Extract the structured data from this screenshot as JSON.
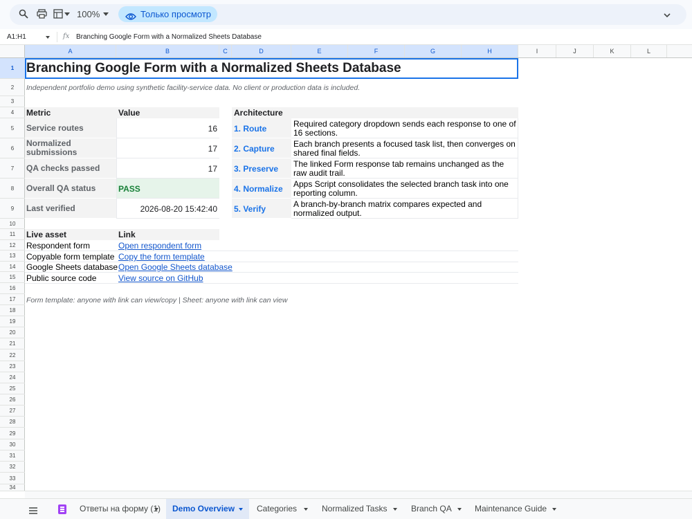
{
  "toolbar": {
    "zoom": "100%",
    "view_only_label": "Только просмотр"
  },
  "formula_bar": {
    "cell_ref": "A1:H1",
    "content": "Branching Google Form with a Normalized Sheets Database"
  },
  "columns": [
    "A",
    "B",
    "C",
    "D",
    "E",
    "F",
    "G",
    "H",
    "I",
    "J",
    "K",
    "L"
  ],
  "rows": [
    "1",
    "2",
    "3",
    "4",
    "5",
    "6",
    "7",
    "8",
    "9",
    "10",
    "11",
    "12",
    "13",
    "14",
    "15",
    "16",
    "17",
    "18",
    "19",
    "20",
    "21",
    "22",
    "23",
    "24",
    "25",
    "26",
    "27",
    "28",
    "29",
    "30",
    "31",
    "32",
    "33",
    "34"
  ],
  "sheet": {
    "title": "Branching Google Form with a Normalized Sheets Database",
    "subtitle": "Independent portfolio demo using synthetic facility-service data. No client or production data is included.",
    "metrics_header": {
      "metric": "Metric",
      "value": "Value"
    },
    "metrics": [
      {
        "label": "Service routes",
        "value": "16"
      },
      {
        "label": "Normalized submissions",
        "label_line1": "Normalized",
        "label_line2": "submissions",
        "value": "17"
      },
      {
        "label": "QA checks passed",
        "value": "17"
      },
      {
        "label": "Overall QA status",
        "value": "PASS",
        "status_color": "#188038"
      },
      {
        "label": "Last verified",
        "value": "2026-08-20 15:42:40"
      }
    ],
    "architecture_header": "Architecture",
    "architecture": [
      {
        "step": "1. Route",
        "desc": "Required category dropdown sends each response to one of 16 sections."
      },
      {
        "step": "2. Capture",
        "desc": "Each branch presents a focused task list, then converges on shared final fields."
      },
      {
        "step": "3. Preserve",
        "desc": "The linked Form response tab remains unchanged as the raw audit trail."
      },
      {
        "step": "4. Normalize",
        "desc": "Apps Script consolidates the selected branch task into one reporting column."
      },
      {
        "step": "5. Verify",
        "desc": "A branch-by-branch matrix compares expected and normalized output."
      }
    ],
    "assets_header": {
      "asset": "Live asset",
      "link": "Link"
    },
    "assets": [
      {
        "name": "Respondent form",
        "link": "Open respondent form"
      },
      {
        "name": "Copyable form template",
        "link": "Copy the form template"
      },
      {
        "name": "Google Sheets database",
        "link": "Open Google Sheets database"
      },
      {
        "name": "Public source code",
        "link": "View source on GitHub"
      }
    ],
    "footnote": "Form template: anyone with link can view/copy | Sheet: anyone with link can view"
  },
  "tabs": [
    {
      "label": "Ответы на форму (1)",
      "active": false,
      "icon": "form-icon"
    },
    {
      "label": "Demo Overview",
      "active": true
    },
    {
      "label": "Categories",
      "active": false
    },
    {
      "label": "Normalized Tasks",
      "active": false
    },
    {
      "label": "Branch QA",
      "active": false
    },
    {
      "label": "Maintenance Guide",
      "active": false
    }
  ],
  "colors": {
    "accent": "#1a73e8",
    "link": "#1155cc",
    "pass": "#188038",
    "view_only_bg": "#c2e7ff"
  }
}
